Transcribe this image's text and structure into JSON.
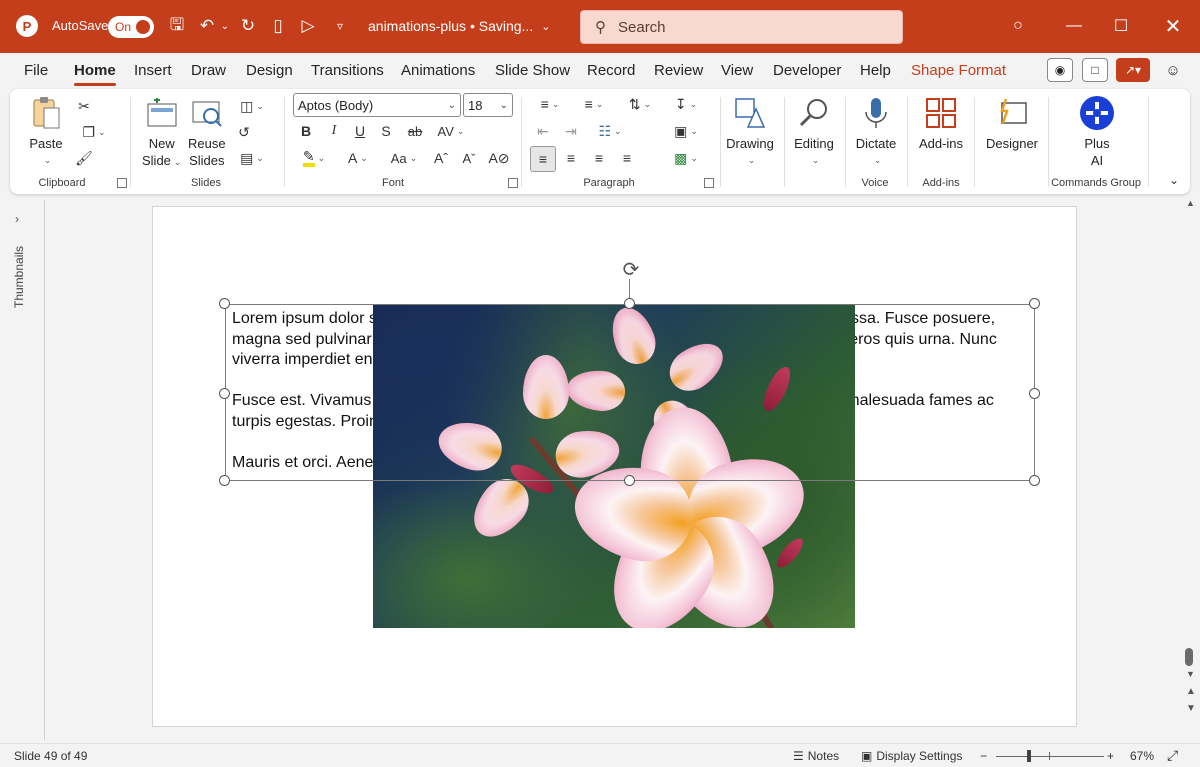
{
  "titlebar": {
    "autosave_label": "AutoSave",
    "autosave_state": "On",
    "doc_title": "animations-plus • Saving...",
    "search_placeholder": "Search",
    "accent": "#c43e1c"
  },
  "tabs": [
    "File",
    "Home",
    "Insert",
    "Draw",
    "Design",
    "Transitions",
    "Animations",
    "Slide Show",
    "Record",
    "Review",
    "View",
    "Developer",
    "Help",
    "Shape Format"
  ],
  "active_tab": "Home",
  "ribbon": {
    "paste": "Paste",
    "new_slide_1": "New",
    "new_slide_2": "Slide",
    "reuse_1": "Reuse",
    "reuse_2": "Slides",
    "font_name": "Aptos (Body)",
    "font_size": "18",
    "drawing": "Drawing",
    "editing": "Editing",
    "dictate": "Dictate",
    "addins": "Add-ins",
    "designer": "Designer",
    "plus_ai_1": "Plus",
    "plus_ai_2": "AI",
    "groups": {
      "clipboard": "Clipboard",
      "slides": "Slides",
      "font": "Font",
      "paragraph": "Paragraph",
      "voice": "Voice",
      "addins": "Add-ins",
      "commands": "Commands Group"
    }
  },
  "thumbnails_label": "Thumbnails",
  "slide": {
    "paragraphs": [
      "Lorem ipsum dolor sit amet, consectetuer adipiscing elit. Maecenas porttitor congue massa. Fusce posuere, magna sed pulvinar ultricies, purus lectus malesuada libero, sit amet commodo magna eros quis urna. Nunc viverra imperdiet enim.",
      "Fusce est. Vivamus a tellus. Pellentesque habitant morbi tristique senectus et netus et malesuada fames ac turpis egestas. Proin pharetra nonummy pede.",
      "Mauris et orci. Aenean nec lorem."
    ]
  },
  "statusbar": {
    "slide_counter": "Slide 49 of 49",
    "notes": "Notes",
    "display_settings": "Display Settings",
    "zoom_minus": "−",
    "zoom_plus": "+",
    "zoom_level": "67%"
  }
}
